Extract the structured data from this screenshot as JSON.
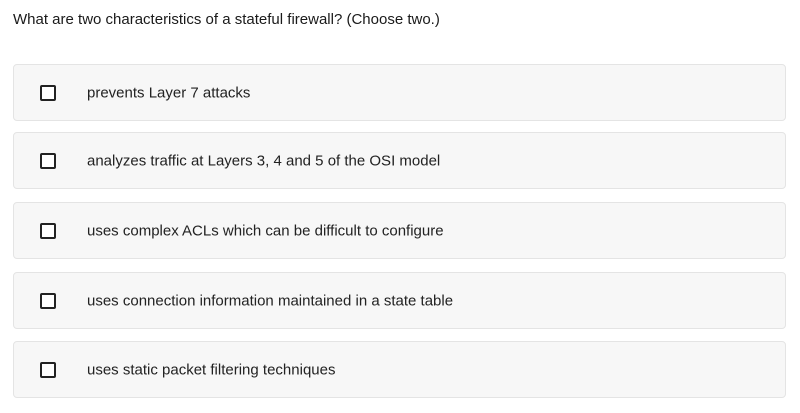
{
  "question": "What are two characteristics of a stateful firewall? (Choose two.)",
  "options": [
    {
      "label": "prevents Layer 7 attacks",
      "checked": false
    },
    {
      "label": "analyzes traffic at Layers 3, 4 and 5 of the OSI model",
      "checked": false
    },
    {
      "label": "uses complex ACLs which can be difficult to configure",
      "checked": false
    },
    {
      "label": "uses connection information maintained in a state table",
      "checked": false
    },
    {
      "label": "uses static packet filtering techniques",
      "checked": false
    }
  ]
}
